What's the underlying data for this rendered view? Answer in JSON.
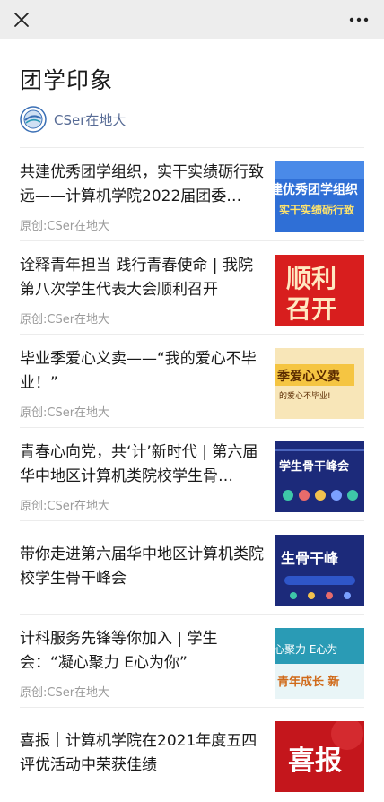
{
  "topbar": {
    "close_icon": "close-icon",
    "more_icon": "more-icon"
  },
  "page": {
    "title": "团学印象"
  },
  "account": {
    "name": "CSer在地大",
    "avatar_icon": "logo-icon"
  },
  "articles": [
    {
      "title": "共建优秀团学组织，实干实绩砺行致远——计算机学院2022届团委…",
      "meta": "原创:CSer在地大",
      "thumb": {
        "line1": "建优秀团学组织",
        "line2": "实干实绩砺行致",
        "bg": "#2f6fd6"
      }
    },
    {
      "title": "诠释青年担当 践行青春使命 | 我院第八次学生代表大会顺利召开",
      "meta": "原创:CSer在地大",
      "thumb": {
        "line1": "顺利",
        "line2": "召开",
        "bg": "#d81e1e"
      }
    },
    {
      "title": "毕业季爱心义卖——“我的爱心不毕业！”",
      "meta": "原创:CSer在地大",
      "thumb": {
        "line1": "季爱心义卖",
        "line2": "的爱心不毕业!",
        "bg": "#f5c542"
      }
    },
    {
      "title": "青春心向党，共‘计’新时代 | 第六届华中地区计算机类院校学生骨…",
      "meta": "原创:CSer在地大",
      "thumb": {
        "line1": "学生骨干峰会",
        "line2": "",
        "bg": "#1c2a7a"
      }
    },
    {
      "title": "带你走进第六届华中地区计算机类院校学生骨干峰会",
      "meta": "",
      "thumb": {
        "line1": "生骨干峰",
        "line2": "",
        "bg": "#1c2a7a"
      }
    },
    {
      "title": "计科服务先锋等你加入 | 学生会：“凝心聚力 E心为你”",
      "meta": "原创:CSer在地大",
      "thumb": {
        "line1": "心聚力  E心为",
        "line2": "青年成长 新",
        "bg": "#2a9bb5"
      }
    },
    {
      "title": "喜报｜计算机学院在2021年度五四评优活动中荣获佳绩",
      "meta": "",
      "thumb": {
        "line1": "喜报",
        "line2": "",
        "bg": "#c4161c"
      }
    }
  ]
}
